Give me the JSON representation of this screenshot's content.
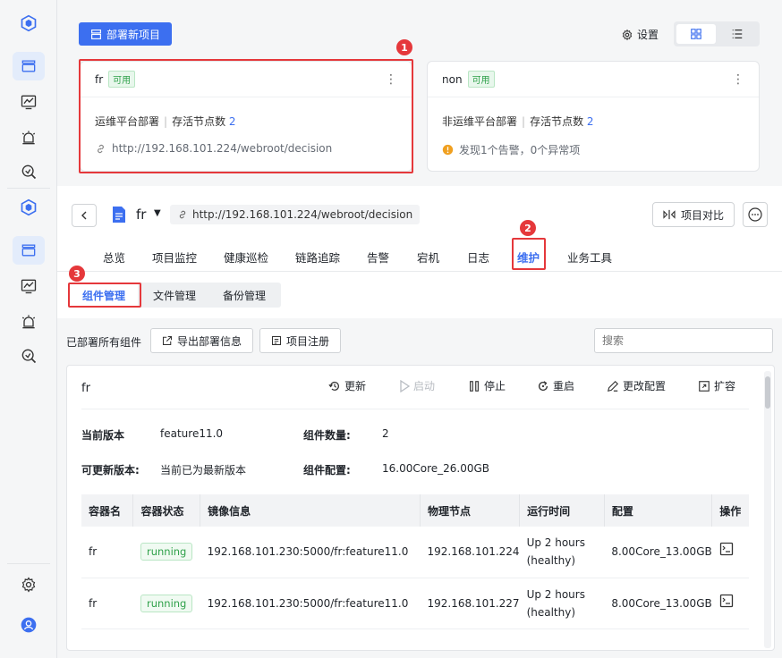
{
  "top": {
    "deploy_label": "部署新项目",
    "settings_label": "设置",
    "cards": [
      {
        "name": "fr",
        "status": "可用",
        "type": "运维平台部署",
        "nodes_label": "存活节点数",
        "nodes": "2",
        "extra": "http://192.168.101.224/webroot/decision"
      },
      {
        "name": "non",
        "status": "可用",
        "type": "非运维平台部署",
        "nodes_label": "存活节点数",
        "nodes": "2",
        "extra": "发现1个告警，0个异常项"
      }
    ]
  },
  "annotations": [
    "1",
    "2",
    "3"
  ],
  "project": {
    "name": "fr",
    "url": "http://192.168.101.224/webroot/decision",
    "compare_label": "项目对比"
  },
  "tabs": [
    "总览",
    "项目监控",
    "健康巡检",
    "链路追踪",
    "告警",
    "宕机",
    "日志",
    "维护",
    "业务工具"
  ],
  "subtabs": [
    "组件管理",
    "文件管理",
    "备份管理"
  ],
  "toolbar": {
    "label": "已部署所有组件",
    "export_label": "导出部署信息",
    "register_label": "项目注册",
    "search_placeholder": "搜索"
  },
  "component": {
    "name": "fr",
    "actions": [
      "更新",
      "启动",
      "停止",
      "重启",
      "更改配置",
      "扩容"
    ],
    "info": {
      "version_label": "当前版本",
      "version": "feature11.0",
      "count_label": "组件数量:",
      "count": "2",
      "update_label": "可更新版本:",
      "update": "当前已为最新版本",
      "config_label": "组件配置:",
      "config": "16.00Core_26.00GB"
    },
    "columns": [
      "容器名",
      "容器状态",
      "镜像信息",
      "物理节点",
      "运行时间",
      "配置",
      "操作"
    ],
    "rows": [
      {
        "name": "fr",
        "status": "running",
        "image": "192.168.101.230:5000/fr:feature11.0",
        "node": "192.168.101.224",
        "uptime1": "Up 2 hours",
        "uptime2": "(healthy)",
        "config": "8.00Core_13.00GB"
      },
      {
        "name": "fr",
        "status": "running",
        "image": "192.168.101.230:5000/fr:feature11.0",
        "node": "192.168.101.227",
        "uptime1": "Up 2 hours",
        "uptime2": "(healthy)",
        "config": "8.00Core_13.00GB"
      }
    ]
  }
}
